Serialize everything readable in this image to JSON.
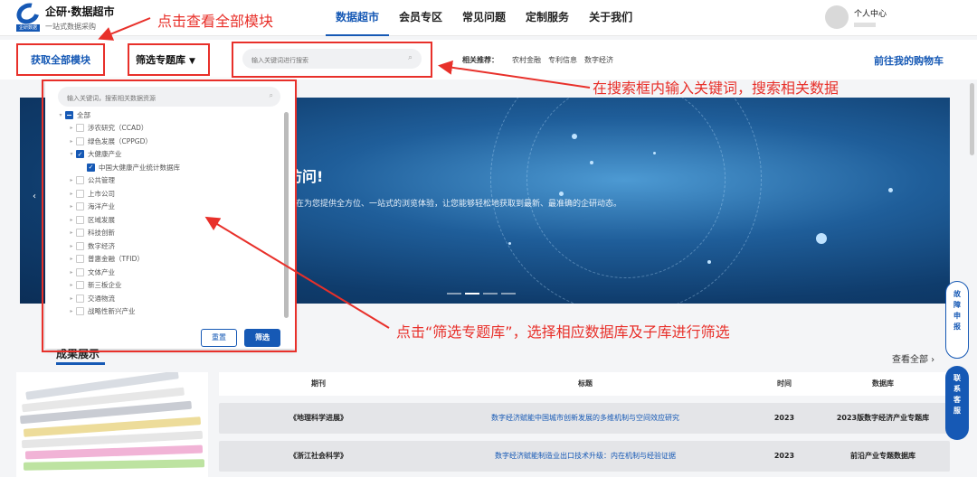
{
  "header": {
    "brand_name": "企研·数据超市",
    "brand_slogan": "一站式数据采购",
    "logo_tag": "企研数据",
    "nav": [
      "数据超市",
      "会员专区",
      "常见问题",
      "定制服务",
      "关于我们"
    ],
    "active_nav": "数据超市",
    "user_label": "个人中心"
  },
  "annotations": {
    "view_all_modules": "点击查看全部模块",
    "search_hint": "在搜索框内输入关键词，搜索相关数据",
    "filter_hint": "点击“筛选专题库”，选择相应数据库及子库进行筛选"
  },
  "toolbar": {
    "get_all_modules": "获取全部模块",
    "filter_label": "筛选专题库",
    "search_placeholder": "输入关键词进行搜索",
    "recommend_label": "相关推荐：",
    "recommend_tags": [
      "农村金融",
      "专利信息",
      "数字经济"
    ],
    "cart_link": "前往我的购物车"
  },
  "banner": {
    "title_fragment": "访问!",
    "description_fragment": "将在为您提供全方位、一站式的浏览体验，让您能够轻松地获取到最新、最准确的企研动态。"
  },
  "filter_panel": {
    "search_placeholder": "输入关键词，搜索相关数据资源",
    "tree": [
      {
        "label": "全部",
        "level": 0,
        "expander": "▾",
        "state": "half"
      },
      {
        "label": "涉农研究（CCAD）",
        "level": 1,
        "expander": "▸",
        "state": "off"
      },
      {
        "label": "绿色发展（CPPGD）",
        "level": 1,
        "expander": "▸",
        "state": "off"
      },
      {
        "label": "大健康产业",
        "level": 1,
        "expander": "▾",
        "state": "on"
      },
      {
        "label": "中国大健康产业统计数据库",
        "level": 2,
        "expander": "",
        "state": "on"
      },
      {
        "label": "公共管理",
        "level": 1,
        "expander": "▸",
        "state": "off"
      },
      {
        "label": "上市公司",
        "level": 1,
        "expander": "▸",
        "state": "off"
      },
      {
        "label": "海洋产业",
        "level": 1,
        "expander": "▸",
        "state": "off"
      },
      {
        "label": "区域发展",
        "level": 1,
        "expander": "▸",
        "state": "off"
      },
      {
        "label": "科技创新",
        "level": 1,
        "expander": "▸",
        "state": "off"
      },
      {
        "label": "数字经济",
        "level": 1,
        "expander": "▸",
        "state": "off"
      },
      {
        "label": "普惠金融（TFID）",
        "level": 1,
        "expander": "▸",
        "state": "off"
      },
      {
        "label": "文体产业",
        "level": 1,
        "expander": "▸",
        "state": "off"
      },
      {
        "label": "新三板企业",
        "level": 1,
        "expander": "▸",
        "state": "off"
      },
      {
        "label": "交通物流",
        "level": 1,
        "expander": "▸",
        "state": "off"
      },
      {
        "label": "战略性新兴产业",
        "level": 1,
        "expander": "▸",
        "state": "off"
      }
    ],
    "reset_button": "重置",
    "filter_button": "筛选"
  },
  "news": {
    "section_title": "成果展示",
    "view_all": "查看全部 ›",
    "columns": [
      "期刊",
      "标题",
      "时间",
      "数据库"
    ],
    "rows": [
      {
        "journal": "《地理科学进展》",
        "title": "数字经济赋能中国城市创新发展的多维机制与空间效应研究",
        "year": "2023",
        "database": "2023版数字经济产业专题库"
      },
      {
        "journal": "《浙江社会科学》",
        "title": "数字经济赋能制造业出口技术升级：内在机制与经验证据",
        "year": "2023",
        "database": "前沿产业专题数据库"
      }
    ]
  },
  "side_widgets": {
    "report": "故障申报",
    "contact": "联系客服"
  },
  "colors": {
    "brand_blue": "#1659b5",
    "annotation_red": "#e8302a"
  }
}
